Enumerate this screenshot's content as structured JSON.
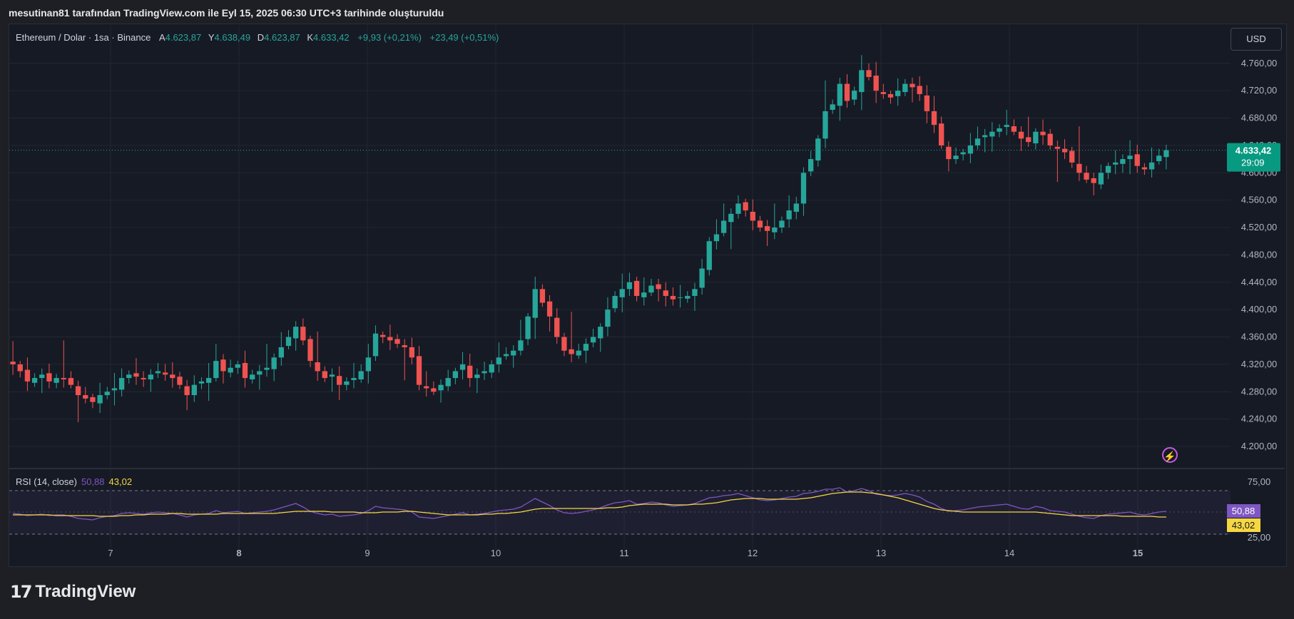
{
  "header": {
    "created_by": "mesutinan81 tarafından TradingView.com ile Eyl 15, 2025 06:30 UTC+3 tarihinde oluşturuldu"
  },
  "legend": {
    "symbol": "Ethereum / Dolar · 1sa · Binance",
    "open_label": "A",
    "open": "4.623,87",
    "high_label": "Y",
    "high": "4.638,49",
    "low_label": "D",
    "low": "4.623,87",
    "close_label": "K",
    "close": "4.633,42",
    "change": "+9,93 (+0,21%)",
    "change2": "+23,49 (+0,51%)"
  },
  "currency_button": "USD",
  "price_badge": {
    "price": "4.633,42",
    "countdown": "29:09"
  },
  "rsi": {
    "label": "RSI (14, close)",
    "value": "50,88",
    "ma_value": "43,02"
  },
  "brand": {
    "name": "TradingView"
  },
  "colors": {
    "up": "#26a69a",
    "down": "#ef5350",
    "rsi": "#7e57c2",
    "rsi_ma": "#f5d742",
    "badge": "#089981"
  },
  "chart_data": {
    "type": "candlestick",
    "x_ticks": [
      "7",
      "8",
      "9",
      "10",
      "11",
      "12",
      "13",
      "14",
      "15"
    ],
    "y_ticks": [
      "4.760,00",
      "4.720,00",
      "4.680,00",
      "4.640,00",
      "4.600,00",
      "4.560,00",
      "4.520,00",
      "4.480,00",
      "4.440,00",
      "4.400,00",
      "4.360,00",
      "4.320,00",
      "4.280,00",
      "4.240,00",
      "4.200,00"
    ],
    "ylim": [
      4200,
      4760
    ],
    "rsi_ticks": [
      "75,00",
      "25,00"
    ],
    "rsi_levels": [
      70,
      30
    ],
    "closes": [
      4320,
      4310,
      4295,
      4300,
      4305,
      4295,
      4300,
      4298,
      4290,
      4275,
      4270,
      4265,
      4275,
      4280,
      4285,
      4300,
      4305,
      4302,
      4298,
      4305,
      4310,
      4305,
      4300,
      4290,
      4275,
      4290,
      4295,
      4300,
      4325,
      4310,
      4315,
      4320,
      4300,
      4305,
      4310,
      4315,
      4330,
      4345,
      4360,
      4375,
      4355,
      4325,
      4310,
      4300,
      4305,
      4290,
      4295,
      4300,
      4310,
      4330,
      4365,
      4360,
      4355,
      4350,
      4345,
      4330,
      4290,
      4285,
      4280,
      4290,
      4300,
      4310,
      4320,
      4300,
      4305,
      4310,
      4320,
      4330,
      4335,
      4340,
      4355,
      4390,
      4430,
      4410,
      4390,
      4360,
      4340,
      4335,
      4340,
      4350,
      4360,
      4375,
      4400,
      4420,
      4430,
      4440,
      4420,
      4425,
      4435,
      4430,
      4420,
      4415,
      4418,
      4420,
      4430,
      4460,
      4500,
      4510,
      4530,
      4540,
      4555,
      4545,
      4530,
      4520,
      4515,
      4520,
      4530,
      4545,
      4555,
      4600,
      4620,
      4650,
      4690,
      4700,
      4730,
      4705,
      4720,
      4750,
      4740,
      4720,
      4715,
      4710,
      4720,
      4730,
      4725,
      4715,
      4690,
      4670,
      4640,
      4620,
      4625,
      4630,
      4640,
      4650,
      4655,
      4660,
      4665,
      4670,
      4660,
      4650,
      4645,
      4660,
      4655,
      4640,
      4635,
      4630,
      4615,
      4600,
      4590,
      4585,
      4600,
      4610,
      4615,
      4620,
      4625,
      4610,
      4605,
      4615,
      4625,
      4633
    ],
    "rsi_values": [
      48,
      47,
      45,
      46,
      47,
      45,
      46,
      46,
      44,
      41,
      40,
      39,
      42,
      44,
      45,
      48,
      49,
      48,
      47,
      49,
      50,
      49,
      48,
      46,
      43,
      46,
      47,
      48,
      52,
      49,
      50,
      51,
      48,
      49,
      50,
      51,
      53,
      56,
      59,
      62,
      57,
      51,
      48,
      46,
      47,
      44,
      45,
      46,
      48,
      52,
      58,
      56,
      55,
      54,
      53,
      50,
      43,
      42,
      41,
      43,
      45,
      47,
      49,
      46,
      47,
      48,
      50,
      52,
      53,
      54,
      57,
      63,
      69,
      64,
      59,
      53,
      49,
      48,
      49,
      51,
      53,
      56,
      60,
      63,
      64,
      66,
      61,
      62,
      64,
      63,
      60,
      58,
      59,
      60,
      62,
      66,
      70,
      71,
      73,
      74,
      76,
      73,
      70,
      67,
      66,
      67,
      69,
      71,
      72,
      76,
      77,
      79,
      82,
      82,
      84,
      78,
      80,
      83,
      80,
      75,
      74,
      73,
      74,
      76,
      74,
      71,
      65,
      61,
      55,
      51,
      52,
      53,
      55,
      57,
      58,
      59,
      60,
      61,
      58,
      55,
      54,
      58,
      56,
      52,
      51,
      50,
      47,
      44,
      42,
      41,
      45,
      47,
      48,
      49,
      50,
      47,
      46,
      48,
      50,
      51
    ],
    "rsi_ma_values": [
      46,
      46,
      46,
      46,
      46,
      46,
      45,
      45,
      45,
      45,
      45,
      45,
      44,
      44,
      44,
      45,
      45,
      46,
      46,
      47,
      47,
      47,
      48,
      48,
      47,
      47,
      47,
      47,
      47,
      48,
      48,
      48,
      48,
      48,
      48,
      48,
      48,
      49,
      50,
      51,
      51,
      51,
      51,
      51,
      50,
      50,
      50,
      50,
      49,
      49,
      49,
      50,
      50,
      50,
      51,
      51,
      50,
      49,
      48,
      47,
      46,
      46,
      46,
      46,
      46,
      47,
      47,
      48,
      48,
      49,
      50,
      52,
      54,
      55,
      55,
      55,
      55,
      55,
      55,
      55,
      55,
      55,
      56,
      56,
      57,
      59,
      60,
      61,
      61,
      61,
      61,
      60,
      60,
      60,
      61,
      61,
      62,
      63,
      65,
      67,
      68,
      69,
      69,
      69,
      68,
      68,
      68,
      68,
      68,
      69,
      70,
      72,
      74,
      76,
      77,
      78,
      78,
      78,
      77,
      76,
      74,
      72,
      70,
      67,
      64,
      61,
      58,
      55,
      53,
      52,
      51,
      50,
      50,
      50,
      50,
      50,
      50,
      50,
      50,
      50,
      50,
      50,
      49,
      48,
      47,
      46,
      45,
      45,
      45,
      45,
      45,
      45,
      45,
      44,
      44,
      44,
      44,
      44,
      43,
      43
    ]
  }
}
